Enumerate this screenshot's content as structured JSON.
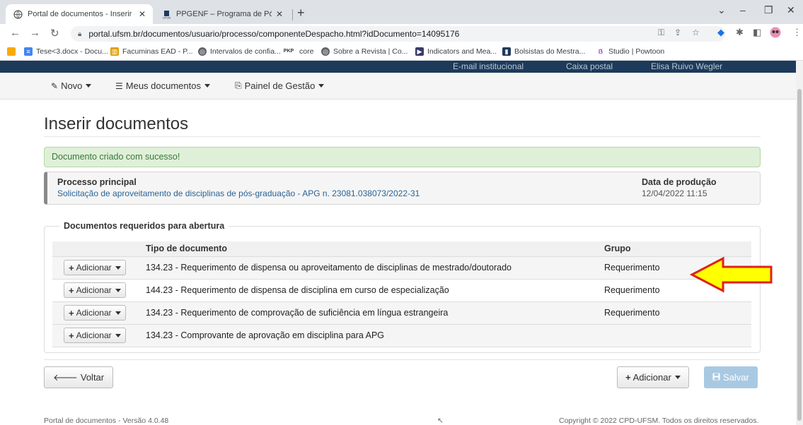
{
  "browser": {
    "tabs": [
      {
        "title": "Portal de documentos - Inserir d",
        "icon": "globe-icon"
      },
      {
        "title": "PPGENF – Programa de Pós-Grad",
        "icon": "ufsm-icon"
      }
    ],
    "new_tab": "+",
    "url": "portal.ufsm.br/documentos/usuario/processo/componenteDespacho.html?idDocumento=14095176",
    "bookmarks": [
      {
        "label": "Tese<3.docx - Docu...",
        "color": "#4285f4"
      },
      {
        "label": "Facuminas EAD - P...",
        "color": "#e0a000"
      },
      {
        "label": "Intervalos de confia...",
        "color": "#5f6368"
      },
      {
        "label": "core",
        "color": "#5f6368"
      },
      {
        "label": "Sobre a Revista | Co...",
        "color": "#5f6368"
      },
      {
        "label": "Indicators and Mea...",
        "color": "#3a3a6a"
      },
      {
        "label": "Bolsistas do Mestra...",
        "color": "#1e3a5a"
      },
      {
        "label": "Studio | Powtoon",
        "color": "#9b4dca"
      }
    ]
  },
  "site_header": {
    "links": [
      "E-mail institucional",
      "Caixa postal",
      "Elisa Ruivo Wegler"
    ]
  },
  "nav": {
    "novo": "Novo",
    "meus_documentos": "Meus documentos",
    "painel": "Painel de Gestão"
  },
  "page": {
    "title": "Inserir documentos",
    "alert": "Documento criado com sucesso!",
    "process_label": "Processo principal",
    "process_value": "Solicitação de aproveitamento de disciplinas de pós-graduação - APG n. 23081.038073/2022-31",
    "date_label": "Data de produção",
    "date_value": "12/04/2022 11:15",
    "section_title": "Documentos requeridos para abertura",
    "table": {
      "headers": [
        "",
        "Tipo de documento",
        "Grupo"
      ],
      "add_label": "Adicionar",
      "rows": [
        {
          "tipo": "134.23 - Requerimento de dispensa ou aproveitamento de disciplinas de mestrado/doutorado",
          "grupo": "Requerimento"
        },
        {
          "tipo": "144.23 - Requerimento de dispensa de disciplina em curso de especialização",
          "grupo": "Requerimento"
        },
        {
          "tipo": "134.23 - Requerimento de comprovação de suficiência em língua estrangeira",
          "grupo": "Requerimento"
        },
        {
          "tipo": "134.23 - Comprovante de aprovação em disciplina para APG",
          "grupo": ""
        }
      ]
    },
    "buttons": {
      "voltar": "Voltar",
      "adicionar": "Adicionar",
      "salvar": "Salvar"
    },
    "footer_left": "Portal de documentos - Versão 4.0.48",
    "footer_right": "Copyright © 2022 CPD-UFSM. Todos os direitos reservados.",
    "annotation_arrow_color": "#ffff00"
  }
}
